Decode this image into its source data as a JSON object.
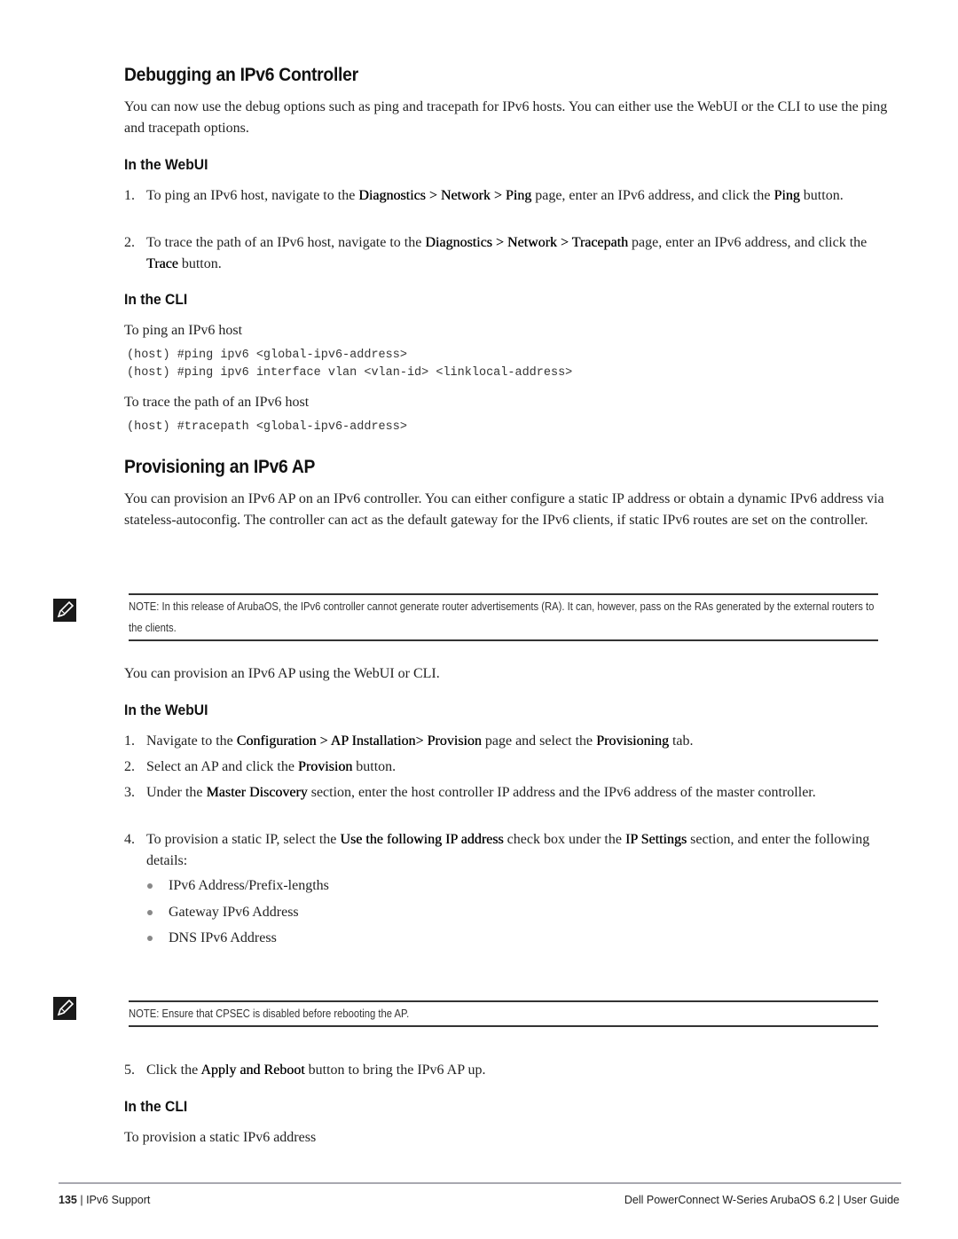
{
  "section1": {
    "title": "Debugging an IPv6 Controller",
    "intro": "You can now use the debug options such as ping and tracepath for IPv6 hosts. You can either use the WebUI or the CLI to use the ping and tracepath options.",
    "webui": {
      "heading": "In the WebUI",
      "steps": [
        {
          "num": "1.",
          "parts": [
            "To ping an IPv6 host, navigate to the ",
            "Diagnostics > Network > Ping",
            " page, enter an IPv6 address, and click the ",
            "Ping",
            " button."
          ]
        },
        {
          "num": "2.",
          "parts": [
            "To trace the path of an IPv6 host, navigate to the ",
            "Diagnostics > Network > Tracepath",
            " page, enter an IPv6 address, and click the ",
            "Trace",
            " button."
          ]
        }
      ]
    },
    "cli": {
      "heading": "In the CLI",
      "ping_label": "To ping an IPv6 host",
      "ping_cmds": [
        "(host) #ping ipv6 <global-ipv6-address>",
        "(host) #ping ipv6 interface vlan <vlan-id> <linklocal-address>"
      ],
      "trace_label": "To trace the path of an IPv6 host",
      "trace_cmds": [
        "(host) #tracepath <global-ipv6-address>"
      ]
    }
  },
  "section2": {
    "title": "Provisioning an IPv6 AP",
    "intro": "You can provision an IPv6 AP on an IPv6 controller. You can either configure a static IP address or obtain a dynamic IPv6 address via stateless-autoconfig. The controller can act as the default gateway for the IPv6 clients, if static IPv6 routes are set on the controller.",
    "note1": "NOTE: In this release of ArubaOS, the IPv6 controller cannot generate router advertisements (RA). It can, however, pass on the RAs generated by the external routers to the clients.",
    "provision_text": "You can provision an IPv6 AP using the WebUI or CLI.",
    "webui": {
      "heading": "In the WebUI",
      "steps": [
        {
          "num": "1.",
          "parts": [
            "Navigate to the ",
            "Configuration > AP Installation> Provision",
            " page and select the ",
            "Provisioning",
            " tab."
          ]
        },
        {
          "num": "2.",
          "parts": [
            "Select an AP and click the ",
            "Provision",
            " button."
          ]
        },
        {
          "num": "3.",
          "parts": [
            "Under the ",
            "Master Discovery",
            " section, enter the host controller IP address and the IPv6 address of the master controller."
          ]
        },
        {
          "num": "4.",
          "parts": [
            "To provision a static IP, select the ",
            "Use the following IP address",
            " check box under the ",
            "IP Settings",
            " section, and enter the following details:"
          ]
        }
      ],
      "bullets": [
        "IPv6 Address/Prefix-lengths",
        "Gateway IPv6 Address",
        "DNS IPv6 Address"
      ],
      "note2": "NOTE: Ensure that CPSEC is disabled before rebooting the AP.",
      "step5": {
        "num": "5.",
        "parts": [
          "Click the ",
          "Apply and Reboot",
          " button to bring the IPv6 AP up."
        ]
      }
    },
    "cli": {
      "heading": "In the CLI",
      "static_label": "To provision a static IPv6 address"
    }
  },
  "footer": {
    "page_number": "135",
    "chapter": "IPv6 Support",
    "guide": "Dell PowerConnect W-Series ArubaOS 6.2  |  User Guide"
  }
}
